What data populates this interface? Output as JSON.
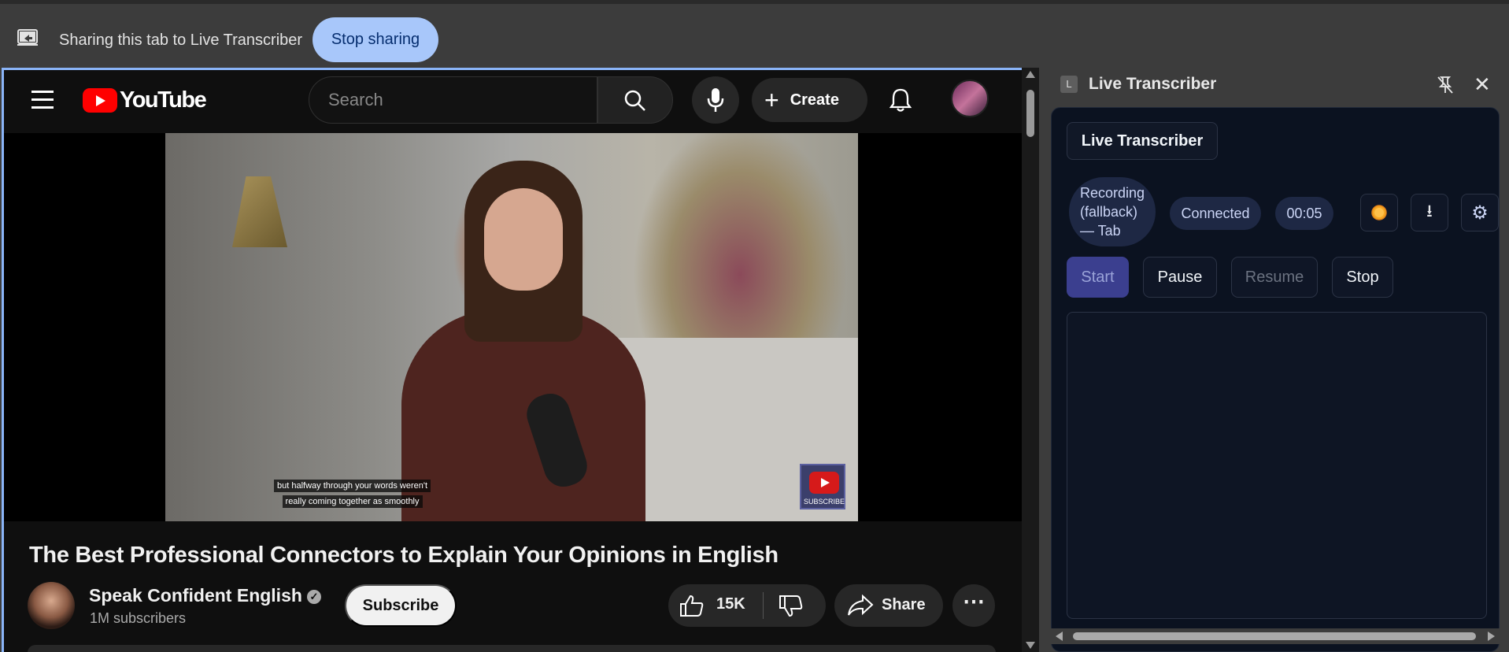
{
  "share_bar": {
    "text": "Sharing this tab to Live Transcriber",
    "stop_label": "Stop sharing"
  },
  "youtube": {
    "logo_text": "YouTube",
    "search_placeholder": "Search",
    "create_label": "Create",
    "captions": [
      "but halfway through your words weren't",
      "really coming together as smoothly"
    ],
    "subscribe_badge": "SUBSCRIBE",
    "video_title": "The Best Professional Connectors to Explain Your Opinions in English",
    "channel_name": "Speak Confident English",
    "verified_mark": "✓",
    "subscribers": "1M subscribers",
    "subscribe_label": "Subscribe",
    "like_count": "15K",
    "share_label": "Share",
    "more_label": "⋯"
  },
  "transcriber": {
    "header_badge": "L",
    "header_title": "Live Transcriber",
    "close_glyph": "✕",
    "app_title": "Live Transcriber",
    "status_recording": "Recording (fallback) — Tab",
    "status_connection": "Connected",
    "timer": "00:05",
    "download_glyph": "⭳",
    "settings_glyph": "⚙",
    "controls": {
      "start": "Start",
      "pause": "Pause",
      "resume": "Resume",
      "stop": "Stop"
    },
    "transcript_text": ""
  },
  "colors": {
    "stop_share_bg": "#a8c7fa",
    "yt_red": "#ff0000",
    "start_bg": "#3b3f8f",
    "panel_bg": "#0b1220"
  }
}
